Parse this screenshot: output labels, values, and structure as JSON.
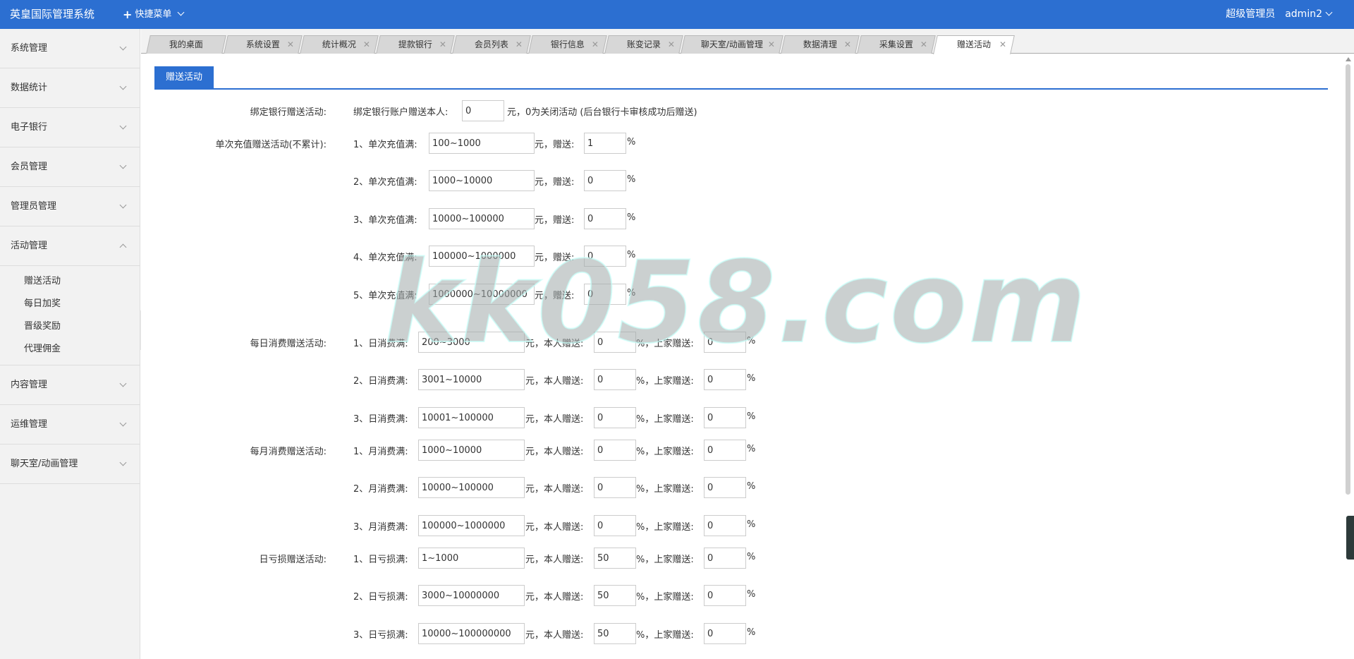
{
  "header": {
    "app_title": "英皇国际管理系统",
    "quick_menu": "快捷菜单",
    "role": "超级管理员",
    "username": "admin2"
  },
  "sidebar": {
    "groups": [
      {
        "label": "系统管理"
      },
      {
        "label": "数据统计"
      },
      {
        "label": "电子银行"
      },
      {
        "label": "会员管理"
      },
      {
        "label": "管理员管理"
      },
      {
        "label": "活动管理"
      },
      {
        "label": "内容管理"
      },
      {
        "label": "运维管理"
      },
      {
        "label": "聊天室/动画管理"
      }
    ],
    "activity_items": [
      "赠送活动",
      "每日加奖",
      "晋级奖励",
      "代理佣金"
    ]
  },
  "tabs": [
    "我的桌面",
    "系统设置",
    "统计概况",
    "提款银行",
    "会员列表",
    "银行信息",
    "账变记录",
    "聊天室/动画管理",
    "数据清理",
    "采集设置",
    "赠送活动"
  ],
  "panel": {
    "title": "赠送活动"
  },
  "form": {
    "bind_bank": {
      "label": "绑定银行赠送活动:",
      "prefix": "绑定银行账户赠送本人:",
      "value": "0",
      "suffix": "元，0为关闭活动 (后台银行卡审核成功后赠送)"
    },
    "single_recharge": {
      "label": "单次充值赠送活动(不累计):",
      "rows": [
        {
          "prefix": "1、单次充值满:",
          "range": "100~1000",
          "mid": "元，赠送:",
          "pct": "1",
          "unit": "%"
        },
        {
          "prefix": "2、单次充值满:",
          "range": "1000~10000",
          "mid": "元，赠送:",
          "pct": "0",
          "unit": "%"
        },
        {
          "prefix": "3、单次充值满:",
          "range": "10000~100000",
          "mid": "元，赠送:",
          "pct": "0",
          "unit": "%"
        },
        {
          "prefix": "4、单次充值满:",
          "range": "100000~1000000",
          "mid": "元，赠送:",
          "pct": "0",
          "unit": "%"
        },
        {
          "prefix": "5、单次充值满:",
          "range": "1000000~10000000",
          "mid": "元，赠送:",
          "pct": "0",
          "unit": "%"
        }
      ]
    },
    "daily_consume": {
      "label": "每日消费赠送活动:",
      "rows": [
        {
          "prefix": "1、日消费满:",
          "range": "200~3000",
          "mid": "元，本人赠送:",
          "self": "0",
          "mid2": "%，上家赠送:",
          "parent": "0",
          "unit": "%"
        },
        {
          "prefix": "2、日消费满:",
          "range": "3001~10000",
          "mid": "元，本人赠送:",
          "self": "0",
          "mid2": "%，上家赠送:",
          "parent": "0",
          "unit": "%"
        },
        {
          "prefix": "3、日消费满:",
          "range": "10001~100000",
          "mid": "元，本人赠送:",
          "self": "0",
          "mid2": "%，上家赠送:",
          "parent": "0",
          "unit": "%"
        }
      ]
    },
    "monthly_consume": {
      "label": "每月消费赠送活动:",
      "rows": [
        {
          "prefix": "1、月消费满:",
          "range": "1000~10000",
          "mid": "元，本人赠送:",
          "self": "0",
          "mid2": "%，上家赠送:",
          "parent": "0",
          "unit": "%"
        },
        {
          "prefix": "2、月消费满:",
          "range": "10000~100000",
          "mid": "元，本人赠送:",
          "self": "0",
          "mid2": "%，上家赠送:",
          "parent": "0",
          "unit": "%"
        },
        {
          "prefix": "3、月消费满:",
          "range": "100000~1000000",
          "mid": "元，本人赠送:",
          "self": "0",
          "mid2": "%，上家赠送:",
          "parent": "0",
          "unit": "%"
        }
      ]
    },
    "daily_loss": {
      "label": "日亏损赠送活动:",
      "rows": [
        {
          "prefix": "1、日亏损满:",
          "range": "1~1000",
          "mid": "元，本人赠送:",
          "self": "50",
          "mid2": "%，上家赠送:",
          "parent": "0",
          "unit": "%"
        },
        {
          "prefix": "2、日亏损满:",
          "range": "3000~10000000",
          "mid": "元，本人赠送:",
          "self": "50",
          "mid2": "%，上家赠送:",
          "parent": "0",
          "unit": "%"
        },
        {
          "prefix": "3、日亏损满:",
          "range": "10000~100000000",
          "mid": "元，本人赠送:",
          "self": "50",
          "mid2": "%，上家赠送:",
          "parent": "0",
          "unit": "%"
        }
      ]
    }
  },
  "watermark": "kk058.com"
}
